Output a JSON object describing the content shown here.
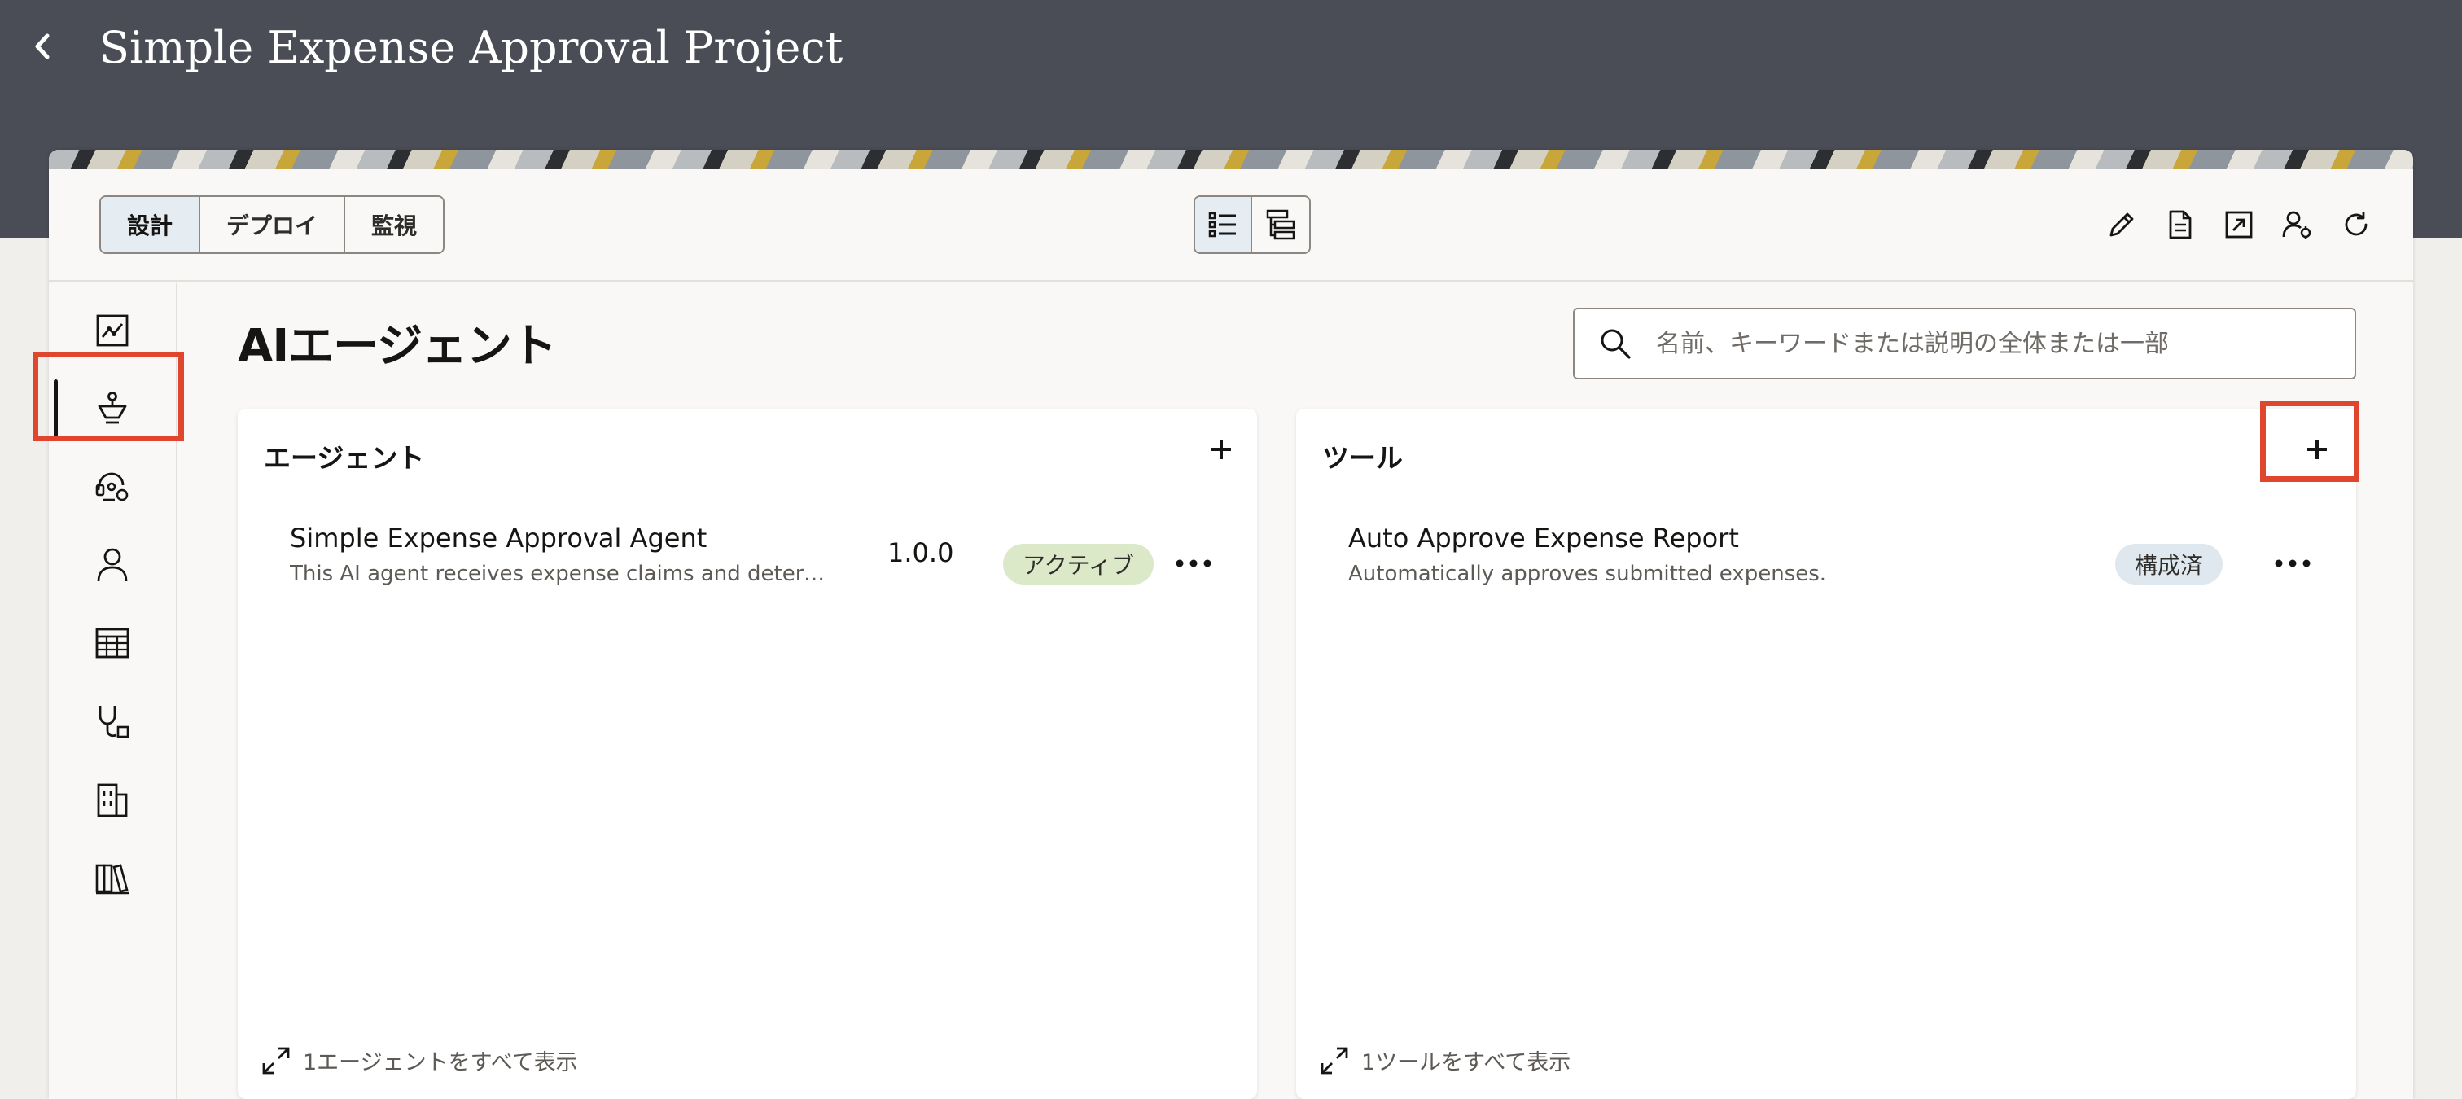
{
  "header": {
    "title": "Simple Expense Approval Project",
    "back_icon": "chevron-left-icon"
  },
  "toolbar": {
    "mode_tabs": [
      {
        "label": "設計",
        "active": true
      },
      {
        "label": "デプロイ",
        "active": false
      },
      {
        "label": "監視",
        "active": false
      }
    ],
    "view_toggle": [
      {
        "icon": "list-view-icon",
        "active": true
      },
      {
        "icon": "hierarchy-view-icon",
        "active": false
      }
    ],
    "actions": [
      "edit-pencil-icon",
      "document-icon",
      "export-icon",
      "user-settings-icon",
      "refresh-icon"
    ]
  },
  "left_nav": {
    "items": [
      {
        "icon": "process-icon",
        "selected": false
      },
      {
        "icon": "ai-agent-icon",
        "selected": true
      },
      {
        "icon": "agent-tool-icon",
        "selected": false
      },
      {
        "icon": "person-icon",
        "selected": false
      },
      {
        "icon": "table-icon",
        "selected": false
      },
      {
        "icon": "stethoscope-icon",
        "selected": false
      },
      {
        "icon": "building-icon",
        "selected": false
      },
      {
        "icon": "library-icon",
        "selected": false
      }
    ]
  },
  "main": {
    "title": "AIエージェント",
    "search": {
      "placeholder": "名前、キーワードまたは説明の全体または一部",
      "value": ""
    },
    "agents_panel": {
      "title": "エージェント",
      "items": [
        {
          "name": "Simple Expense Approval Agent",
          "description": "This AI agent receives expense claims and determin…",
          "version": "1.0.0",
          "status": "アクティブ"
        }
      ],
      "view_all": "1エージェントをすべて表示"
    },
    "tools_panel": {
      "title": "ツール",
      "items": [
        {
          "name": "Auto Approve Expense Report",
          "description": "Automatically approves submitted expenses.",
          "status": "構成済"
        }
      ],
      "view_all": "1ツールをすべて表示"
    }
  },
  "colors": {
    "header_bg": "#4a4d55",
    "highlight": "#e0452e",
    "active_badge": "#dbe9c9",
    "configured_badge": "#dfe8ef",
    "selected_tab": "#e5edf3"
  }
}
